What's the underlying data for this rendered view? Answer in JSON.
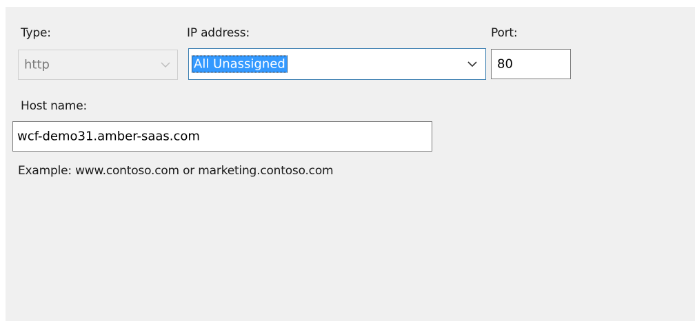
{
  "form": {
    "type": {
      "label": "Type:",
      "value": "http",
      "state": "disabled"
    },
    "ip_address": {
      "label": "IP address:",
      "value": "All Unassigned",
      "state": "focused-selected"
    },
    "port": {
      "label": "Port:",
      "value": "80"
    },
    "host_name": {
      "label": "Host name:",
      "value": "wcf-demo31.amber-saas.com"
    },
    "example_text": "Example: www.contoso.com or marketing.contoso.com"
  },
  "icons": {
    "dropdown": "chevron-down-icon"
  },
  "colors": {
    "panel_background": "#f0f0f0",
    "selection_highlight": "#3399ff",
    "focus_border": "#3c7fb1",
    "disabled_text": "#7a7a7a"
  }
}
